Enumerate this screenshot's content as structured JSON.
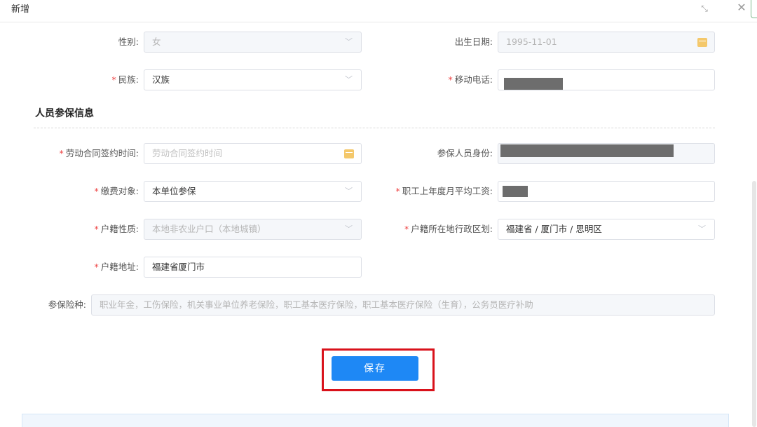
{
  "dialog": {
    "title": "新增"
  },
  "form": {
    "gender": {
      "label": "性别:",
      "value": "女"
    },
    "birth_date": {
      "label": "出生日期:",
      "value": "1995-11-01"
    },
    "ethnicity": {
      "required": "*",
      "label": "民族:",
      "value": "汉族"
    },
    "mobile": {
      "required": "*",
      "label": "移动电话:"
    }
  },
  "insurance_section": {
    "title": "人员参保信息",
    "contract_date": {
      "required": "*",
      "label": "劳动合同签约时间:",
      "placeholder": "劳动合同签约时间"
    },
    "insured_identity": {
      "label": "参保人员身份:"
    },
    "payment_target": {
      "required": "*",
      "label": "缴费对象:",
      "value": "本单位参保"
    },
    "avg_wage": {
      "required": "*",
      "label": "职工上年度月平均工资:"
    },
    "household_type": {
      "required": "*",
      "label": "户籍性质:",
      "value": "本地非农业户口（本地城镇）"
    },
    "household_region": {
      "required": "*",
      "label": "户籍所在地行政区划:",
      "value": "福建省 / 厦门市 / 思明区"
    },
    "household_address": {
      "required": "*",
      "label": "户籍地址:",
      "value": "福建省厦门市"
    },
    "insurance_types": {
      "label": "参保险种:",
      "value": "职业年金，工伤保险，机关事业单位养老保险，职工基本医疗保险，职工基本医疗保险（生育），公务员医疗补助"
    }
  },
  "actions": {
    "save_label": "保存"
  },
  "icons": {
    "maximize": "maximize-icon",
    "close": "close-icon",
    "calendar": "calendar-icon",
    "chevron": "chevron-down-icon"
  },
  "colors": {
    "primary": "#1e88f5",
    "required": "#ee4444",
    "highlight": "#d9121b"
  }
}
